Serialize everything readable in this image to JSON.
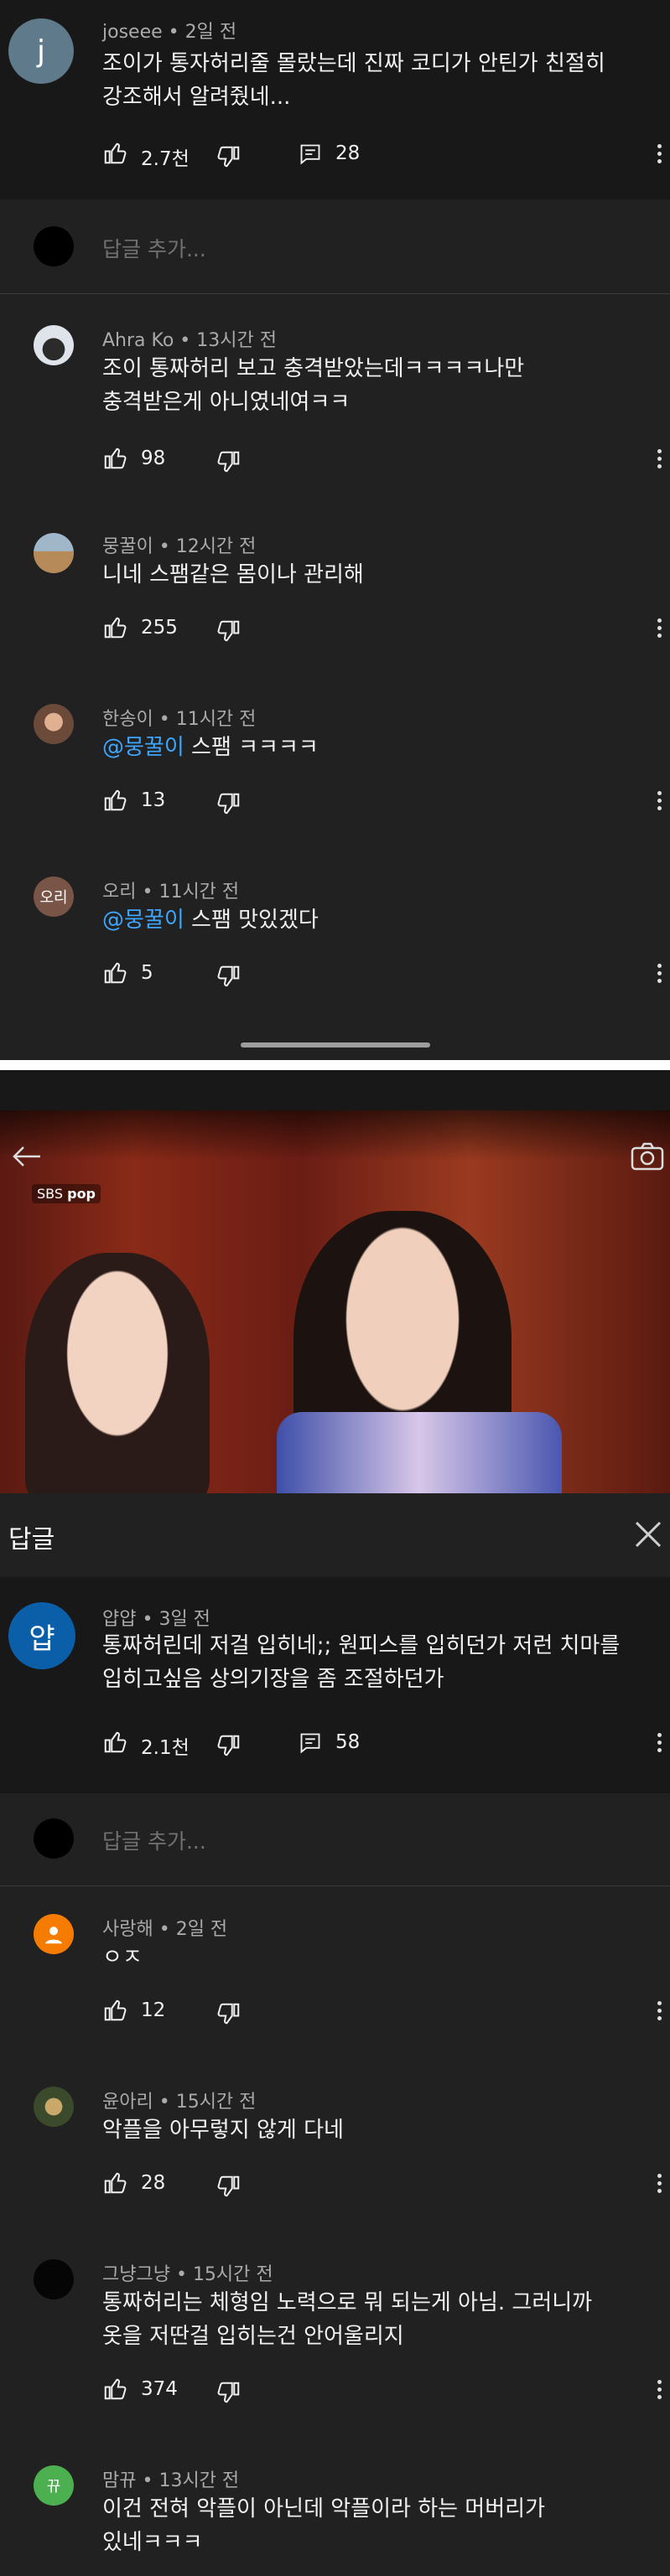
{
  "thread1": {
    "parent": {
      "author": "joseee",
      "time": "2일 전",
      "avatar_letter": "j",
      "line1": "조이가 통자허리줄 몰랐는데  진짜 코디가 안틴가  친절히",
      "line2": "강조해서 알려줬네...",
      "likes": "2.7천",
      "replies": "28"
    },
    "add_reply_placeholder": "답글 추가...",
    "replies": [
      {
        "author": "Ahra Ko",
        "time": "13시간 전",
        "line1": "조이 통짜허리 보고 충격받았는데ㅋㅋㅋㅋ나만",
        "line2": "충격받은게 아니였네여ㅋㅋ",
        "likes": "98"
      },
      {
        "author": "뭉꿀이",
        "time": "12시간 전",
        "line1": "니네 스팸같은 몸이나 관리해",
        "likes": "255"
      },
      {
        "author": "한송이",
        "time": "11시간 전",
        "mention": "@뭉꿀이",
        "line1": " 스팸 ㅋㅋㅋㅋ",
        "likes": "13"
      },
      {
        "author": "오리",
        "time": "11시간 전",
        "avatar_text": "오리",
        "mention": "@뭉꿀이",
        "line1": " 스팸 맛있겠다",
        "likes": "5"
      }
    ]
  },
  "video": {
    "watermark": "SBS",
    "watermark2": "pop"
  },
  "replies_header": {
    "title": "답글"
  },
  "thread2": {
    "parent": {
      "author": "얍얍",
      "time": "3일 전",
      "avatar_text": "얍",
      "line1": "통짜허린데 저걸 입히네;; 원피스를 입히던가 저런 치마를",
      "line2": "입히고싶음 상의기장을 좀 조절하던가",
      "likes": "2.1천",
      "replies": "58"
    },
    "add_reply_placeholder": "답글 추가...",
    "replies": [
      {
        "author": "사랑해",
        "time": "2일 전",
        "line1": "ㅇㅈ",
        "likes": "12"
      },
      {
        "author": "윤아리",
        "time": "15시간 전",
        "line1": "악플을 아무렇지 않게 다네",
        "likes": "28"
      },
      {
        "author": "그냥그냥",
        "time": "15시간 전",
        "line1": "통짜허리는 체형임 노력으로 뭐 되는게 아님. 그러니까",
        "line2": "옷을 저딴걸 입히는건 안어울리지",
        "likes": "374"
      },
      {
        "author": "맘뀨",
        "time": "13시간 전",
        "avatar_text": "뀨",
        "line1": "이건 전혀 악플이 아닌데 악플이라 하는 머버리가",
        "line2": "있네ㅋㅋㅋ"
      }
    ]
  }
}
